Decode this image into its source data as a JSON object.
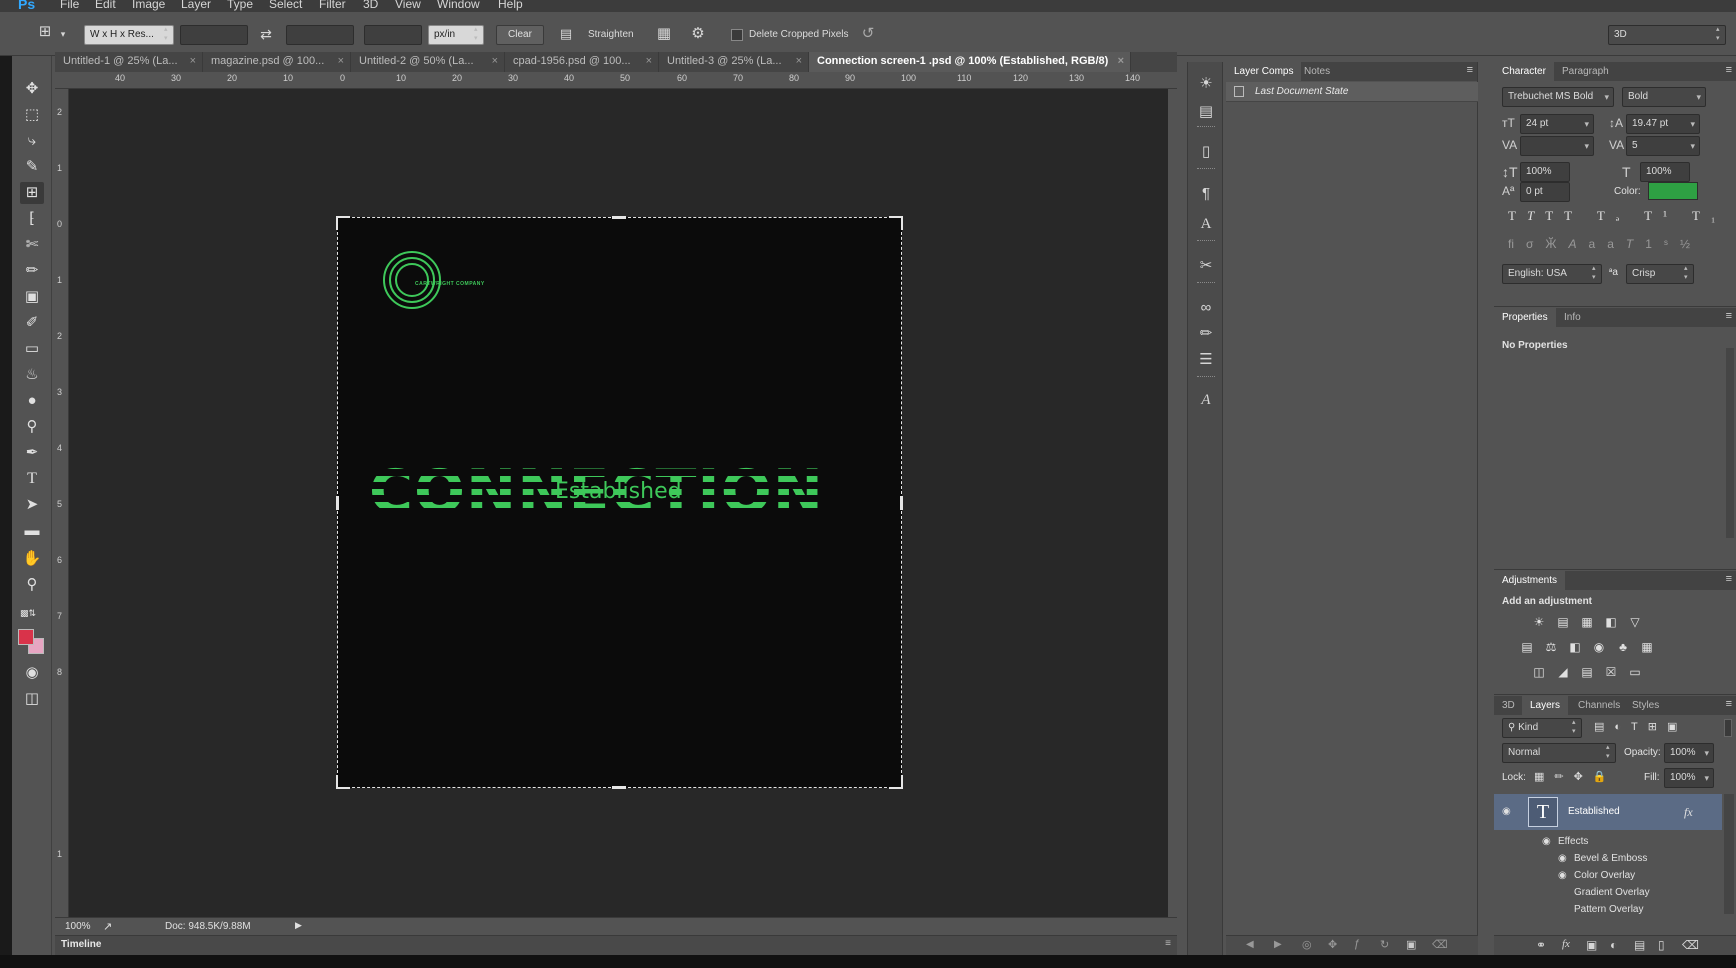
{
  "app": {
    "logo": "Ps"
  },
  "menu": [
    "File",
    "Edit",
    "Image",
    "Layer",
    "Type",
    "Select",
    "Filter",
    "3D",
    "View",
    "Window",
    "Help"
  ],
  "options": {
    "ratio_preset": "W x H x Res...",
    "unit": "px/in",
    "clear": "Clear",
    "straighten": "Straighten",
    "delete_cropped": "Delete Cropped Pixels",
    "workspace": "3D"
  },
  "tabs": [
    {
      "label": "Untitled-1 @ 25% (La..."
    },
    {
      "label": "magazine.psd @ 100..."
    },
    {
      "label": "Untitled-2 @ 50% (La..."
    },
    {
      "label": "cpad-1956.psd @ 100..."
    },
    {
      "label": "Untitled-3 @ 25% (La..."
    },
    {
      "label": "Connection screen-1 .psd @ 100% (Established, RGB/8)"
    }
  ],
  "ruler_h": [
    "40",
    "30",
    "20",
    "10",
    "0",
    "10",
    "20",
    "30",
    "40",
    "50",
    "60",
    "70",
    "80",
    "90",
    "100",
    "110",
    "120",
    "130",
    "140"
  ],
  "ruler_v": [
    "2",
    "1",
    "0",
    "1",
    "2",
    "3",
    "4",
    "5",
    "6",
    "7",
    "8",
    "1"
  ],
  "canvas": {
    "headline": "CONNECTION",
    "subline": "Established",
    "logo_text": "CARTWRIGHT COMPANY",
    "accent": "#3ec85a"
  },
  "status": {
    "zoom": "100%",
    "doc": "Doc: 948.5K/9.88M"
  },
  "timeline": "Timeline",
  "layer_comps": {
    "tabs": [
      "Layer Comps",
      "Notes"
    ],
    "item": "Last Document State"
  },
  "character": {
    "tabs": [
      "Character",
      "Paragraph"
    ],
    "font": "Trebuchet MS Bold",
    "style": "Bold",
    "size": "24 pt",
    "leading": "19.47 pt",
    "tracking": "5",
    "vscale": "100%",
    "hscale": "100%",
    "baseline": "0 pt",
    "color_label": "Color:",
    "color": "#2ea043",
    "language": "English: USA",
    "aa_label": "a",
    "antialias": "Crisp"
  },
  "properties": {
    "tabs": [
      "Properties",
      "Info"
    ],
    "empty": "No Properties"
  },
  "adjustments": {
    "tabs": [
      "Adjustments"
    ],
    "hint": "Add an adjustment"
  },
  "layers": {
    "tabs": [
      "3D",
      "Layers",
      "Channels",
      "Styles"
    ],
    "kind": "Kind",
    "blend": "Normal",
    "opacity_label": "Opacity:",
    "opacity": "100%",
    "lock_label": "Lock:",
    "fill_label": "Fill:",
    "fill": "100%",
    "layer_name": "Established",
    "fx": "fx",
    "effects": "Effects",
    "effect_items": [
      "Bevel & Emboss",
      "Color Overlay",
      "Gradient Overlay",
      "Pattern Overlay"
    ]
  }
}
